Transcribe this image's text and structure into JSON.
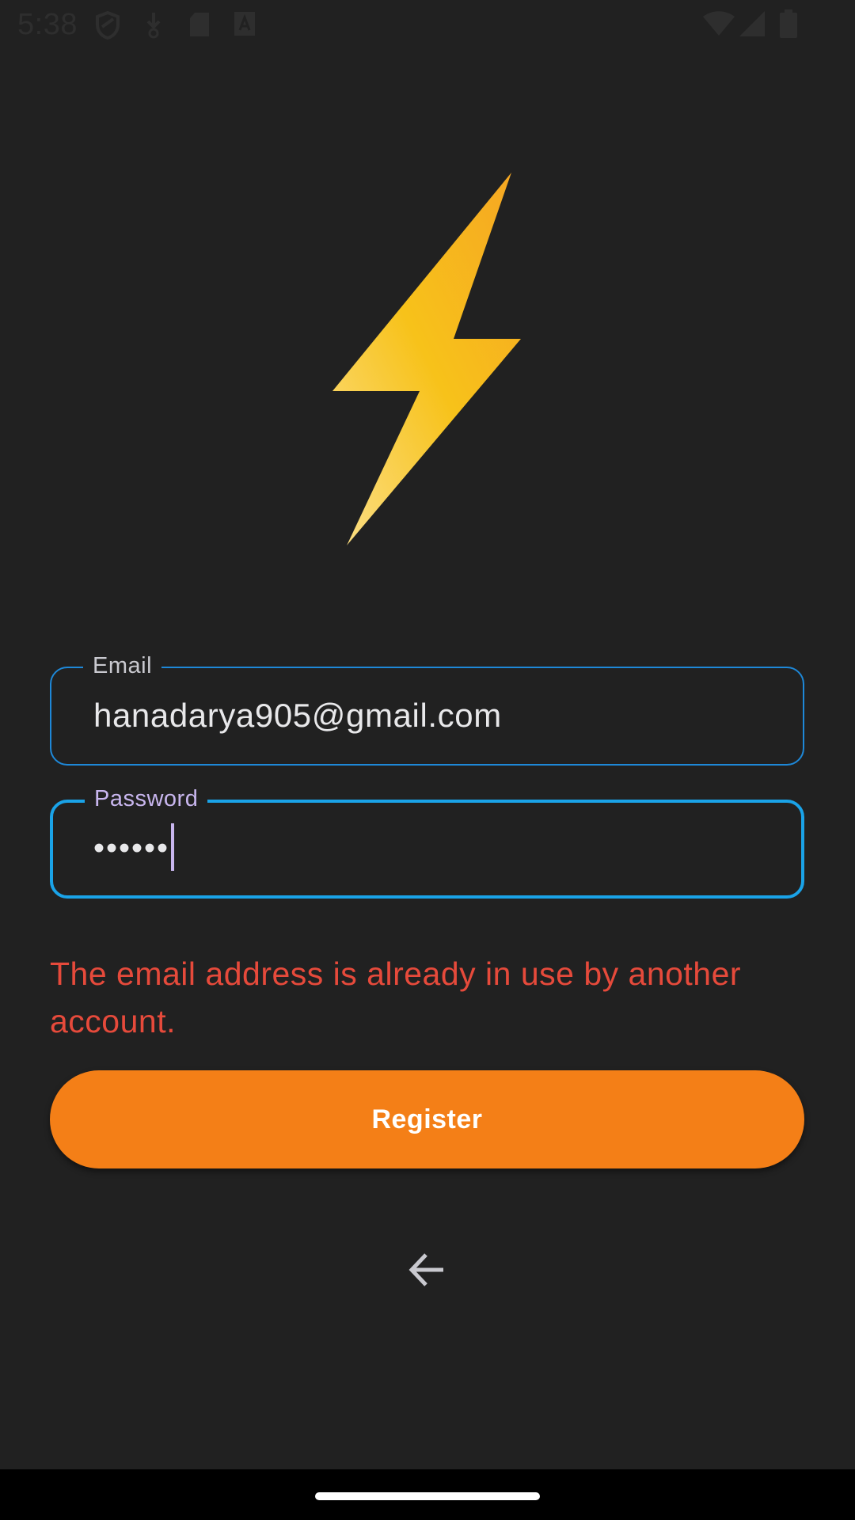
{
  "status_bar": {
    "time": "5:38",
    "left_icons": [
      "shield-icon",
      "download-arrow-icon",
      "sd-card-icon",
      "font-a-icon"
    ],
    "right_icons": [
      "wifi-icon",
      "cellular-signal-icon",
      "battery-icon"
    ]
  },
  "logo": {
    "icon": "lightning-bolt-icon",
    "colors": [
      "#f6a623",
      "#f7c21a",
      "#fbd774"
    ]
  },
  "form": {
    "email": {
      "label": "Email",
      "value": "hanadarya905@gmail.com"
    },
    "password": {
      "label": "Password",
      "value": "••••••"
    },
    "error": "The email address is already in use by another account.",
    "register_label": "Register",
    "back_icon": "arrow-left-icon"
  },
  "colors": {
    "background": "#212121",
    "accent_border": "#1aa3e8",
    "label_focused": "#c8b6ee",
    "error": "#e64a3b",
    "button": "#f47f17"
  }
}
